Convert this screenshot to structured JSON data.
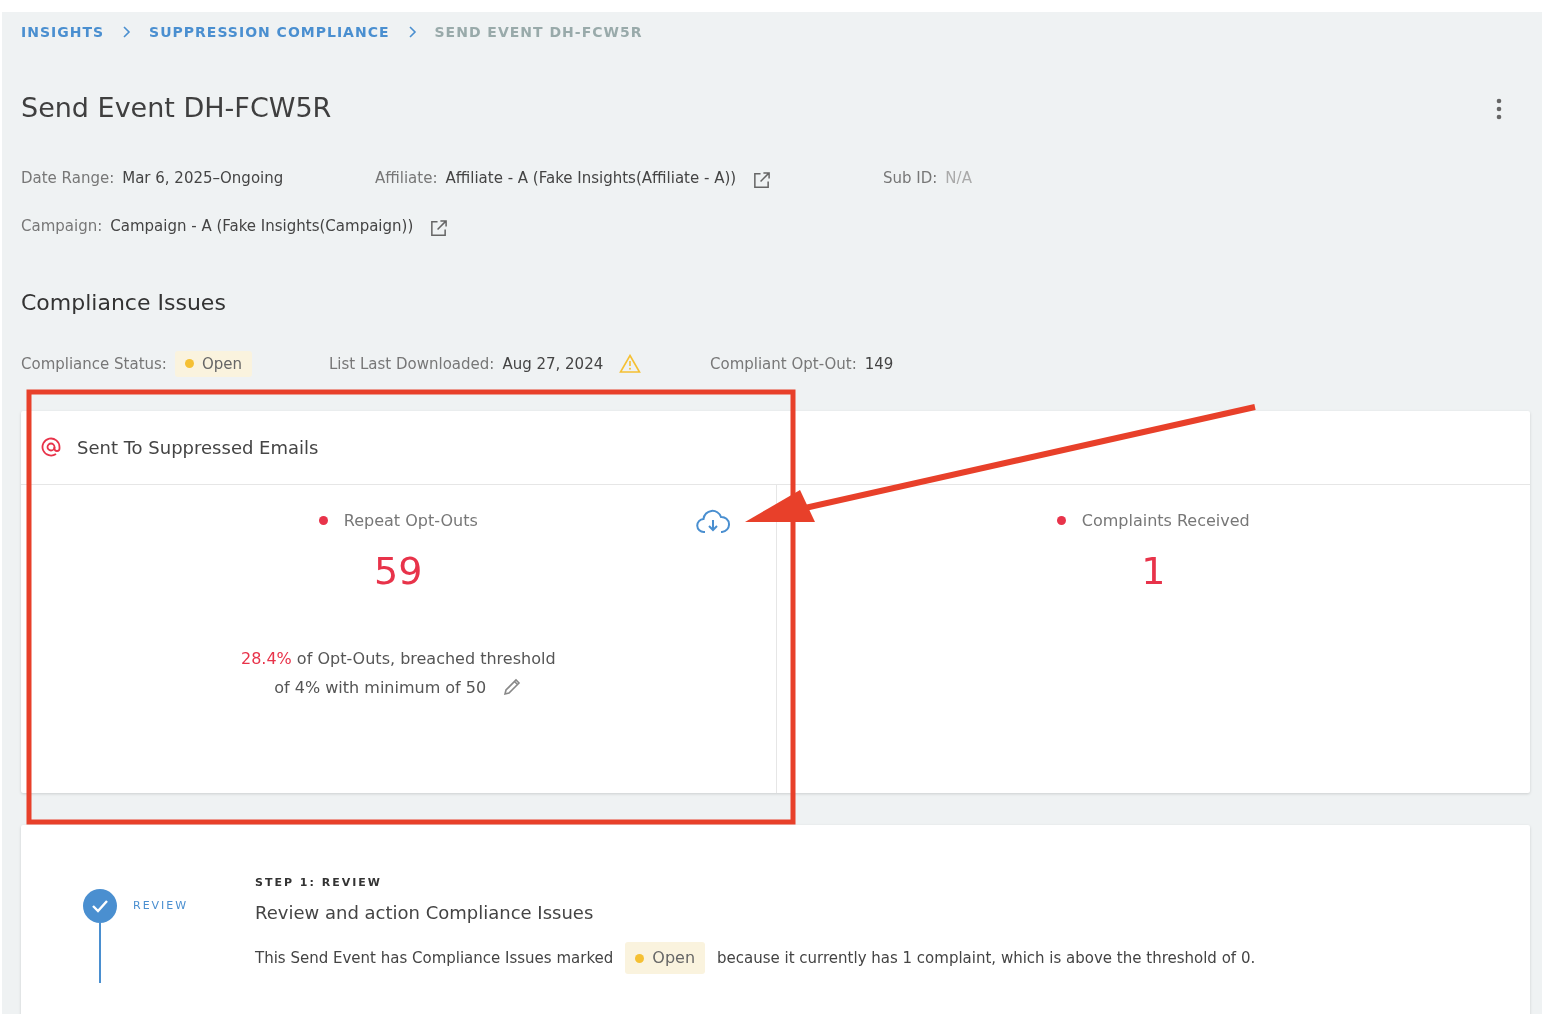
{
  "breadcrumb": [
    {
      "label": "INSIGHTS",
      "kind": "link"
    },
    {
      "label": "SUPPRESSION COMPLIANCE",
      "kind": "link"
    },
    {
      "label": "SEND EVENT DH-FCW5R",
      "kind": "current"
    }
  ],
  "title": "Send Event DH-FCW5R",
  "details": [
    {
      "label": "Date Range:",
      "value": "Mar 6, 2025–Ongoing",
      "external_link": false,
      "muted": false
    },
    {
      "label": "Affiliate:",
      "value": "Affiliate - A (Fake Insights(Affiliate - A))",
      "external_link": true,
      "muted": false
    },
    {
      "label": "Sub ID:",
      "value": "N/A",
      "external_link": false,
      "muted": true
    },
    {
      "label": "Campaign:",
      "value": "Campaign - A (Fake Insights(Campaign))",
      "external_link": true,
      "muted": false
    }
  ],
  "section_title": "Compliance Issues",
  "status_row": [
    {
      "label": "Compliance Status:",
      "kind": "badge",
      "value": "Open",
      "color": "#f5c033"
    },
    {
      "label": "List Last Downloaded:",
      "kind": "warning",
      "value": "Aug 27, 2024"
    },
    {
      "label": "Compliant Opt-Out:",
      "kind": "text",
      "value": "149"
    }
  ],
  "issue_card": {
    "title": "Sent To Suppressed Emails",
    "metrics": [
      {
        "label": "Repeat Opt-Outs",
        "color": "#e8334a",
        "value": "59",
        "download": true,
        "note": "**28.4%** of Opt-Outs, breached threshold",
        "note_2": "of 4% with minimum of 50",
        "editable": true
      },
      {
        "label": "Complaints Received",
        "color": "#e8334a",
        "value": "1",
        "download": false
      }
    ]
  },
  "steps": [
    {
      "step_label": "REVIEW",
      "done": true,
      "heading": "STEP 1: REVIEW",
      "title": "Review and action Compliance Issues",
      "text_before": "This Send Event has Compliance Issues marked",
      "badge": {
        "label": "Open",
        "color": "#f5c033"
      },
      "text_after": "because it currently has 1 complaint, which is above the threshold of 0."
    }
  ],
  "annotations": [
    {
      "kind": "rectangle"
    },
    {
      "kind": "arrow"
    }
  ]
}
